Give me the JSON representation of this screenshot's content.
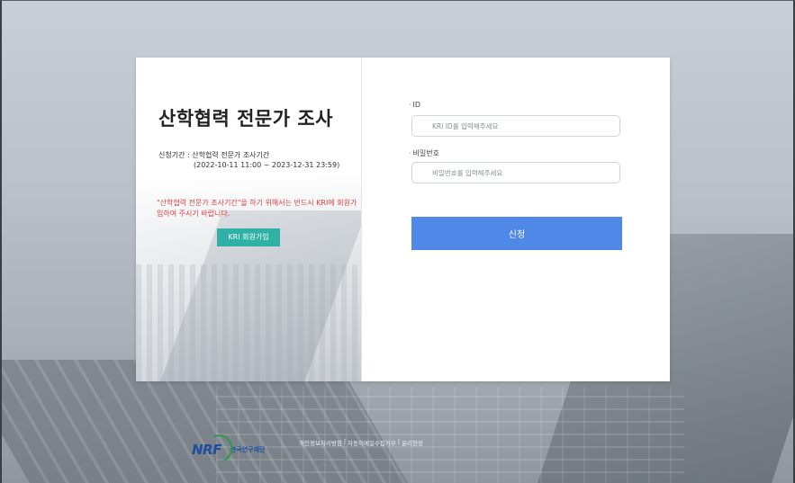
{
  "intro": {
    "title": "산학협력 전문가 조사",
    "period_label": "신청기간 : 산학협력 전문가 조사기간",
    "period_range": "(2022-10-11 11:00 ~ 2023-12-31 23:59)",
    "notice": "\"산학협력 전문가 조사기간\"을 하기 위해서는 반드시 KRI에 회원가입하여 주시기 바랍니다.",
    "signup_button": "KRI 회원가입"
  },
  "login": {
    "id_label": "ID",
    "id_placeholder": "KRI ID를 입력해주세요",
    "password_label": "비밀번호",
    "password_placeholder": "비밀번호를 입력해주세요",
    "submit_button": "신청",
    "label_bullet": "·"
  },
  "footer": {
    "logo_text": "NRF",
    "org_name": "한국연구재단",
    "links": [
      "개인정보처리방침",
      "자동이메일수집거부",
      "윤리현장"
    ],
    "separator": "|"
  },
  "colors": {
    "submit_button": "#5088e8",
    "signup_button": "#2fb2a5",
    "notice_text": "#e03c3c",
    "logo_blue": "#1d4ea0",
    "logo_green": "#2f9a4d"
  }
}
